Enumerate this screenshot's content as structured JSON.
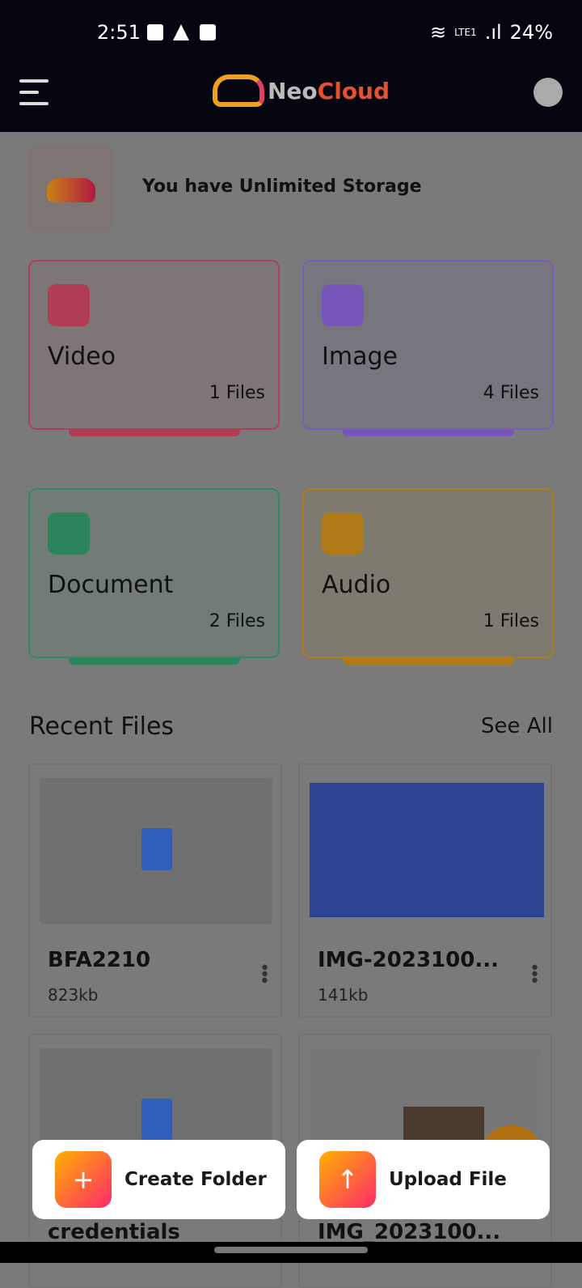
{
  "status": {
    "time": "2:51",
    "battery": "24%",
    "network": "LTE1"
  },
  "header": {
    "brand_a": "Neo",
    "brand_b": "Cloud"
  },
  "storage": {
    "text": "You have Unlimited Storage"
  },
  "categories": [
    {
      "name": "Video",
      "count": "1 Files",
      "color": "#e8516f"
    },
    {
      "name": "Image",
      "count": "4 Files",
      "color": "#9b6ff0"
    },
    {
      "name": "Document",
      "count": "2 Files",
      "color": "#3aaf7a"
    },
    {
      "name": "Audio",
      "count": "1 Files",
      "color": "#e8a020"
    }
  ],
  "recent": {
    "title": "Recent Files",
    "see_all": "See All",
    "files": [
      {
        "name": "BFA2210",
        "size": "823kb"
      },
      {
        "name": "IMG-2023100...",
        "size": "141kb"
      },
      {
        "name": "credentials"
      },
      {
        "name": "IMG_2023100..."
      }
    ]
  },
  "actions": {
    "create_folder": "Create Folder",
    "upload_file": "Upload File"
  }
}
